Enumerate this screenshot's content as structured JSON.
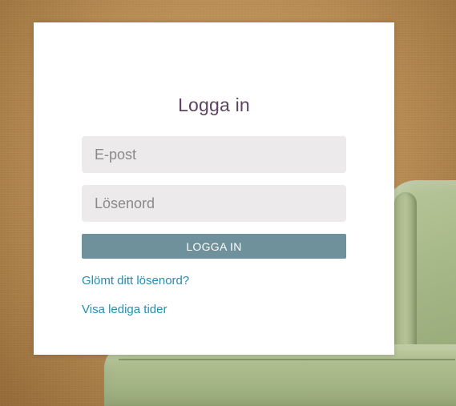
{
  "login": {
    "title": "Logga in",
    "email_placeholder": "E-post",
    "password_placeholder": "Lösenord",
    "submit_label": "LOGGA IN",
    "forgot_password_link": "Glömt ditt lösenord?",
    "available_times_link": "Visa lediga tider"
  },
  "colors": {
    "title": "#5c4560",
    "button_bg": "#6e919c",
    "button_text": "#ffffff",
    "link": "#1f8fb3",
    "input_bg": "#eceaea"
  },
  "background": {
    "description_icon": "couch-photo"
  }
}
